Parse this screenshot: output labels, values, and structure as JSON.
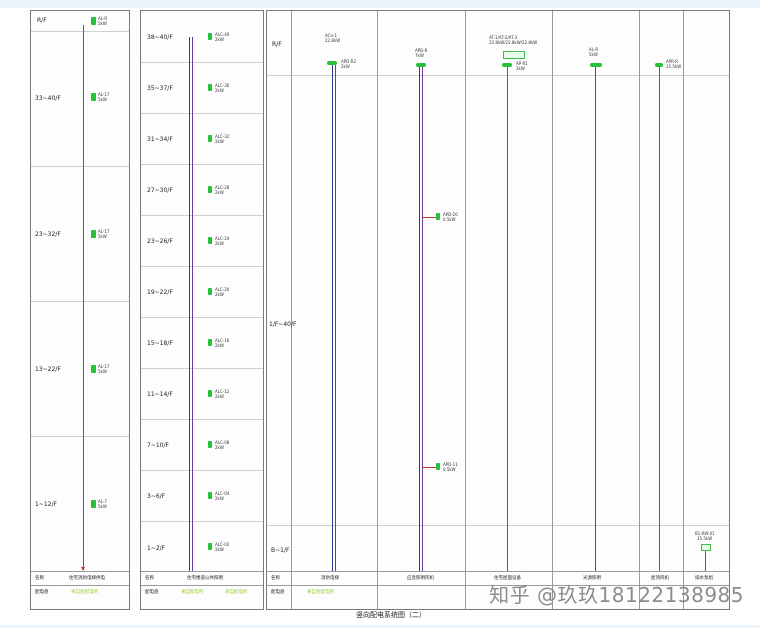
{
  "watermark": "知乎 @玖玖18122138985",
  "caption": "竖向配电系统图（二）",
  "sheet1": {
    "floors": [
      "R/F",
      "33~40/F",
      "23~32/F",
      "13~22/F",
      "1~12/F"
    ],
    "nodes": [
      {
        "id": "AL-R",
        "rating": "5kW"
      },
      {
        "id": "AL-17",
        "rating": "5kW"
      },
      {
        "id": "AL-17",
        "rating": "5kW"
      },
      {
        "id": "AL-17",
        "rating": "5kW"
      },
      {
        "id": "AL-7",
        "rating": "5kW"
      }
    ],
    "footer_left1": "名称",
    "footer_left2": "配电盘",
    "footer_name": "住宅消防电梯供电",
    "footer_green": "来自变配电所"
  },
  "sheet2": {
    "floors": [
      "38~40/F",
      "35~37/F",
      "31~34/F",
      "27~30/F",
      "23~26/F",
      "19~22/F",
      "15~18/F",
      "11~14/F",
      "7~10/F",
      "3~6/F",
      "1~2/F"
    ],
    "nodes": [
      {
        "id": "ALC-40",
        "rating": "2kW"
      },
      {
        "id": "ALC-36",
        "rating": "2kW"
      },
      {
        "id": "ALC-32",
        "rating": "2kW"
      },
      {
        "id": "ALC-28",
        "rating": "2kW"
      },
      {
        "id": "ALC-24",
        "rating": "2kW"
      },
      {
        "id": "ALC-20",
        "rating": "2kW"
      },
      {
        "id": "ALC-16",
        "rating": "2kW"
      },
      {
        "id": "ALC-12",
        "rating": "2kW"
      },
      {
        "id": "ALC-08",
        "rating": "2kW"
      },
      {
        "id": "ALC-04",
        "rating": "2kW"
      },
      {
        "id": "ALC-02",
        "rating": "2kW"
      }
    ],
    "footer_left1": "名称",
    "footer_left2": "配电盘",
    "footer_name": "住宅楼道公共照明",
    "footer_green_a": "来自配电所",
    "footer_green_b": "来自配电所"
  },
  "sheet3": {
    "floors": [
      "R/F",
      "1/F~40/F",
      "B~1/F"
    ],
    "columns": [
      {
        "top_id": "ACn-1",
        "top_rating": "22.8kW",
        "mid_id": "APD-R2",
        "mid_rating": "2kW",
        "footer": "消防电梯"
      },
      {
        "top_id": "APD-R",
        "top_rating": "7kW",
        "mid_id": "APD-20",
        "mid_rating": "0.5kW",
        "low_id": "APD-11",
        "low_rating": "0.5kW",
        "footer": "应急照明风机"
      },
      {
        "top_id": "AT-1/AT-2/AT-3",
        "top_rating": "22.8kW/22.8kW/22.8kW",
        "mid_id": "AP-R1",
        "mid_rating": "2kW",
        "footer": "住宅屋面设备"
      },
      {
        "top_id": "AL-R",
        "top_rating": "5kW",
        "footer": "光源照明"
      },
      {
        "top_id": "APR-R",
        "top_rating": "15.5kW",
        "footer": "屋顶风机"
      },
      {
        "top_id": "B1-RW-01",
        "top_rating": "15.5kW",
        "footer": "排水泵组"
      }
    ],
    "footer_left1": "名称",
    "footer_left2": "配电盘",
    "footer_green": "来自变配电所"
  }
}
